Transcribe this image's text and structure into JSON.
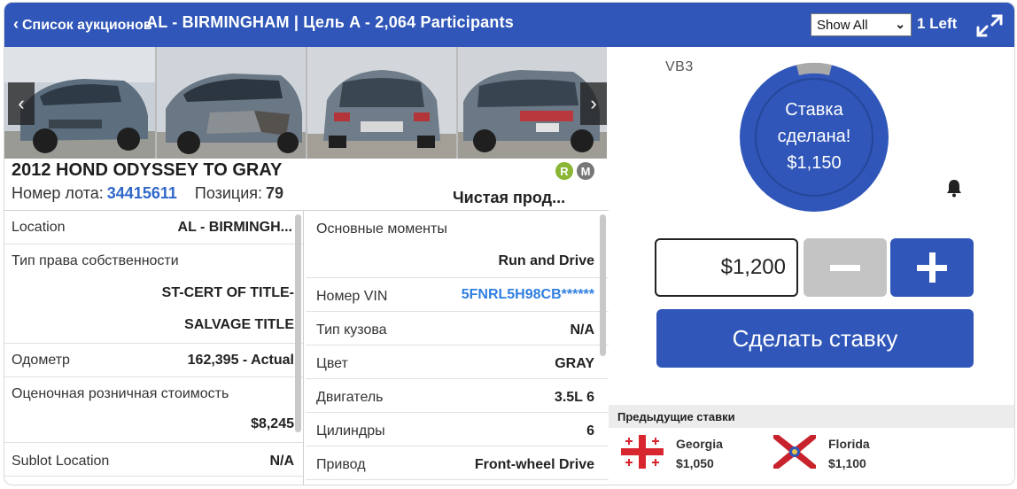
{
  "header": {
    "back_label": "Список аукционов",
    "title": "AL - BIRMINGHAM | Цель A - 2,064 Participants",
    "filter_select": "Show All",
    "left_count": "1 Left"
  },
  "lot": {
    "title": "2012 HOND ODYSSEY TO GRAY",
    "badges": [
      "R",
      "M"
    ],
    "lot_label": "Номер лота:",
    "lot_number": "34415611",
    "position_label": "Позиция:",
    "position_value": "79",
    "sale_type": "Чистая прод..."
  },
  "details_left": [
    {
      "label": "Location",
      "value": "AL - BIRMINGH..."
    },
    {
      "label": "Тип права собственности",
      "value": ""
    },
    {
      "label": "",
      "value": "ST-CERT OF TITLE-"
    },
    {
      "label": "",
      "value": "SALVAGE TITLE"
    },
    {
      "label": "Одометр",
      "value": "162,395 - Actual"
    },
    {
      "label": "Оценочная розничная стоимость",
      "value": ""
    },
    {
      "label": "",
      "value": "$8,245"
    },
    {
      "label": "Sublot Location",
      "value": "N/A"
    }
  ],
  "details_right": [
    {
      "label": "Основные моменты",
      "value": ""
    },
    {
      "label": "",
      "value": "Run and Drive"
    },
    {
      "label": "Номер VIN",
      "value": "5FNRL5H98CB******"
    },
    {
      "label": "Тип кузова",
      "value": "N/A"
    },
    {
      "label": "Цвет",
      "value": "GRAY"
    },
    {
      "label": "Двигатель",
      "value": "3.5L 6"
    },
    {
      "label": "Цилиндры",
      "value": "6"
    },
    {
      "label": "Привод",
      "value": "Front-wheel Drive"
    }
  ],
  "bid": {
    "vb3_label": "VB3",
    "status_line1": "Ставка",
    "status_line2": "сделана!",
    "status_amount": "$1,150",
    "amount": "$1,200",
    "submit_label": "Сделать ставку"
  },
  "previous_bids": {
    "heading": "Предыдущие ставки",
    "items": [
      {
        "state": "Georgia",
        "amount": "$1,050"
      },
      {
        "state": "Florida",
        "amount": "$1,100"
      }
    ]
  },
  "colors": {
    "brand_blue": "#2f56b8",
    "link_blue": "#2f7fe0",
    "badge_r": "#8ab634",
    "badge_m": "#777777"
  }
}
